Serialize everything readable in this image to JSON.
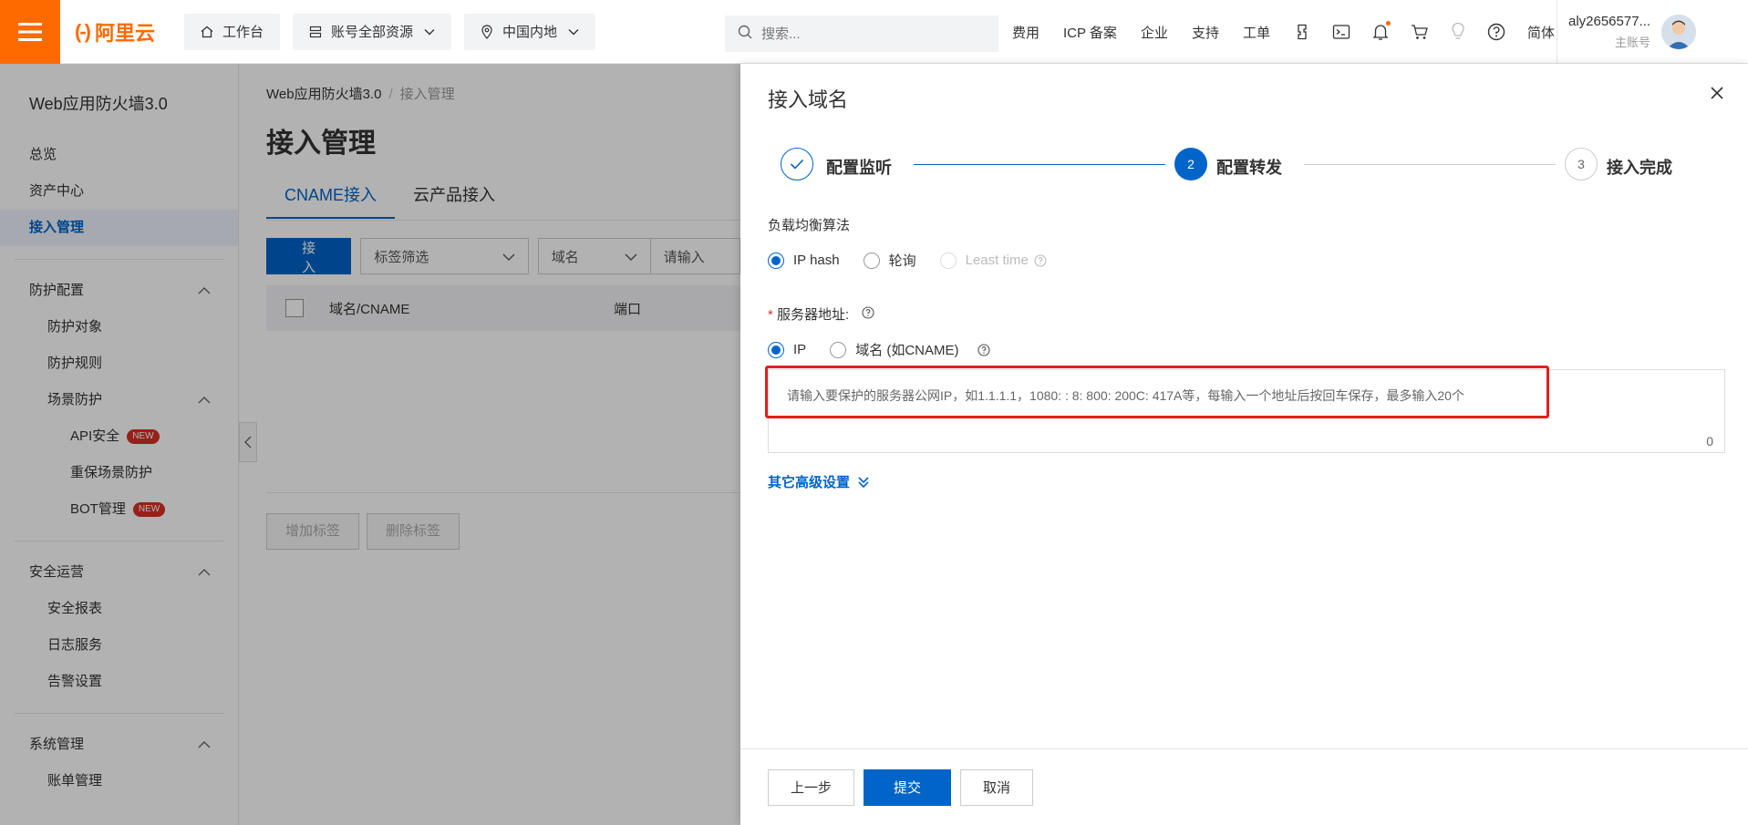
{
  "topbar": {
    "logo_text": "阿里云",
    "workbench": "工作台",
    "resources": "账号全部资源",
    "region": "中国内地",
    "search_placeholder": "搜索...",
    "links": [
      "费用",
      "ICP 备案",
      "企业",
      "支持",
      "工单"
    ],
    "language": "简体",
    "account_name": "aly2656577...",
    "account_sub": "主账号"
  },
  "sidebar": {
    "title": "Web应用防火墙3.0",
    "items": [
      {
        "label": "总览"
      },
      {
        "label": "资产中心"
      },
      {
        "label": "接入管理"
      }
    ],
    "group_protect": {
      "label": "防护配置",
      "items": [
        "防护对象",
        "防护规则"
      ],
      "scene": {
        "label": "场景防护",
        "items": [
          "API安全",
          "重保场景防护",
          "BOT管理"
        ],
        "badge": "NEW"
      }
    },
    "group_ops": {
      "label": "安全运营",
      "items": [
        "安全报表",
        "日志服务",
        "告警设置"
      ]
    },
    "group_sys": {
      "label": "系统管理",
      "items": [
        "账单管理"
      ]
    }
  },
  "main": {
    "breadcrumb": [
      "Web应用防火墙3.0",
      "接入管理"
    ],
    "title": "接入管理",
    "tabs": [
      "CNAME接入",
      "云产品接入"
    ],
    "add_button": "接入",
    "tag_filter": "标签筛选",
    "domain_select": "域名",
    "search_placeholder": "请输入",
    "columns": [
      "域名/CNAME",
      "端口"
    ],
    "add_tag": "增加标签",
    "remove_tag": "删除标签"
  },
  "drawer": {
    "title": "接入域名",
    "steps": [
      {
        "label": "配置监听",
        "status": "done"
      },
      {
        "label": "配置转发",
        "number": "2",
        "status": "active"
      },
      {
        "label": "接入完成",
        "number": "3",
        "status": "pending"
      }
    ],
    "lb_label": "负载均衡算法",
    "lb_options": [
      "IP hash",
      "轮询",
      "Least time"
    ],
    "server_label": "服务器地址:",
    "server_required": "*",
    "server_options": [
      "IP",
      "域名 (如CNAME)"
    ],
    "server_placeholder": "请输入要保护的服务器公网IP，如1.1.1.1，1080: : 8: 800: 200C: 417A等，每输入一个地址后按回车保存，最多输入20个",
    "counter": "0",
    "advanced": "其它高级设置",
    "prev": "上一步",
    "submit": "提交",
    "cancel": "取消"
  },
  "colors": {
    "brand": "#ff6a00",
    "primary": "#0064c8",
    "highlight": "#e0201a"
  }
}
